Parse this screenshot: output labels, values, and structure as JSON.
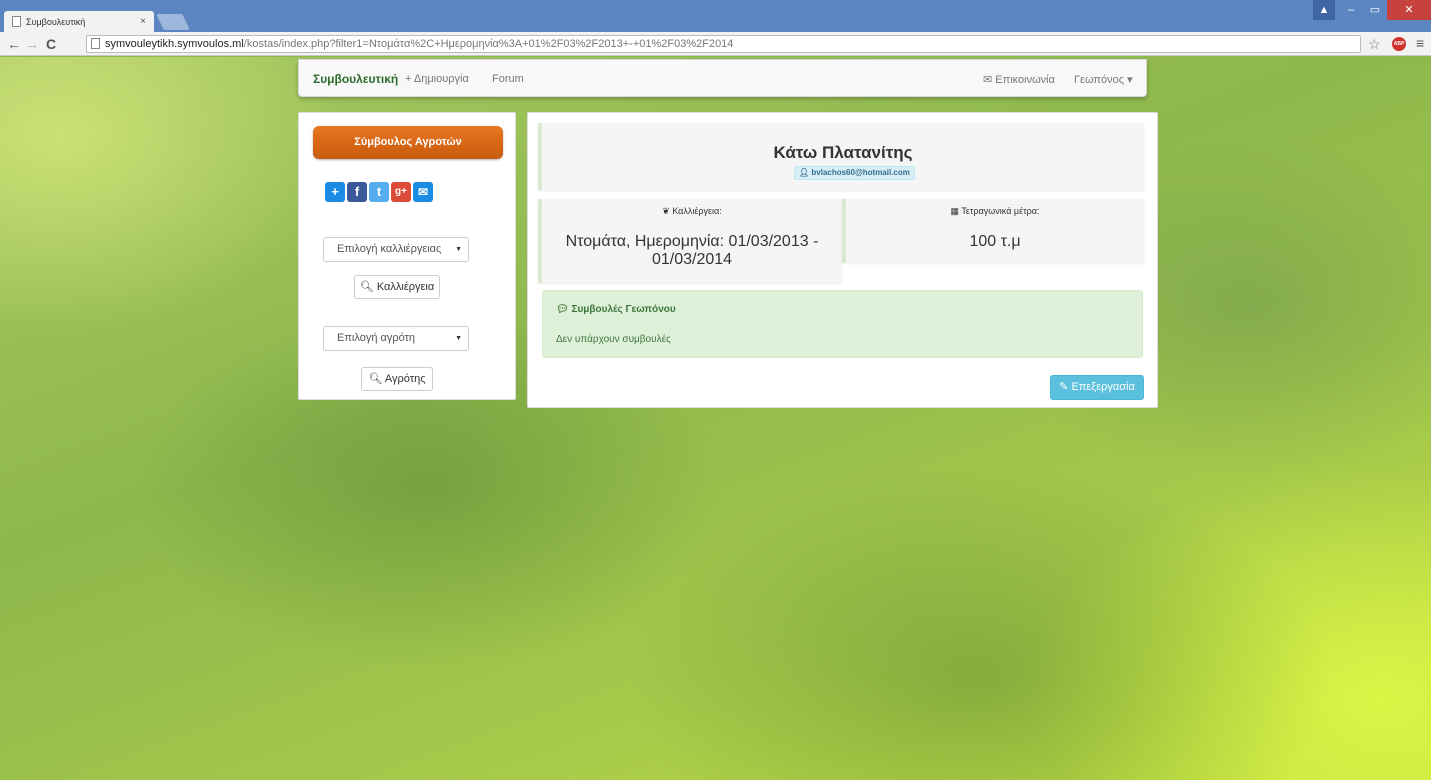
{
  "browser": {
    "tab_title": "Συμβουλευτική",
    "tab_close": "×",
    "url_host": "symvouleytikh.symvoulos.ml",
    "url_path": "/kostas/index.php?filter1=Ντομάτα%2C+Ημερομηνία%3A+01%2F03%2F2013+-+01%2F03%2F2014",
    "back_icon": "←",
    "forward_icon": "→",
    "reload_icon": "C",
    "star_icon": "☆",
    "abp_label": "ABP",
    "menu_icon": "≡",
    "win_min": "–",
    "win_max": "▭",
    "win_close": "✕",
    "win_user": "▲"
  },
  "navbar": {
    "brand": "Συμβουλευτική",
    "create": "+ Δημιουργία",
    "forum": "Forum",
    "contact": "✉ Επικοινωνία",
    "user_menu": "Γεωπόνος ▾"
  },
  "sidebar": {
    "advisor_button": "Σύμβουλος Αγροτών",
    "share_icons": [
      "+",
      "f",
      "t",
      "g+",
      "✉"
    ],
    "crop_select": "Επιλογή καλλιέργειας",
    "crop_button": "🔍︎ Καλλιέργεια",
    "farmer_select": "Επιλογή αγρότη",
    "farmer_button": "🔍︎ Αγρότης",
    "caret": "▼"
  },
  "main": {
    "name": "Κάτω Πλατανίτης",
    "email": "👤︎ bvlachos60@hotmail.com",
    "crop_label": "❦ Καλλιέργεια:",
    "crop_value_line1": "Ντομάτα, Ημερομηνία: 01/03/2013 -",
    "crop_value_line2": "01/03/2014",
    "area_label": "▦ Τετραγωνικά μέτρα:",
    "area_value": "100 τ.μ",
    "advice_heading": "💬︎ Συμβουλές Γεωπόνου",
    "advice_text": "Δεν υπάρχουν συμβουλές",
    "edit_button": "✎ Επεξεργασία"
  },
  "colors": {
    "brand_green": "#2d6b2d",
    "orange": "#e87722",
    "info": "#5bc0de",
    "success_bg": "#dff0d8"
  }
}
